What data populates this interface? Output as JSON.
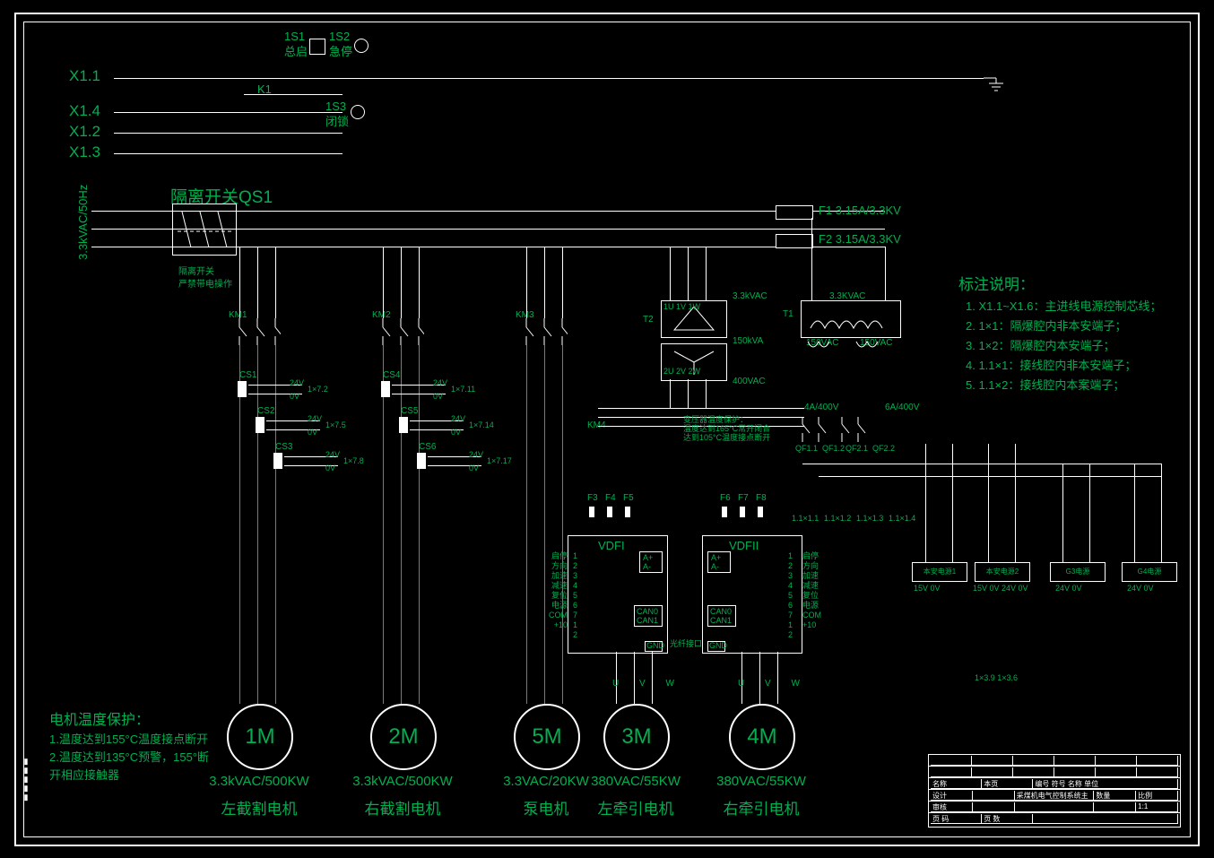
{
  "diagram_title": "采煤机电气控制系统主接线图",
  "top_controls": {
    "s1": {
      "ref": "1S1",
      "label": "总启"
    },
    "s2": {
      "ref": "1S2",
      "label": "急停"
    },
    "s3": {
      "ref": "1S3",
      "label": "闭锁"
    },
    "relay": "K1"
  },
  "control_wires": [
    "X1.1",
    "X1.4",
    "X1.2",
    "X1.3"
  ],
  "supply": {
    "label": "3.3kVAC/50Hz"
  },
  "isolator": {
    "name": "隔离开关QS1",
    "warning": "隔离开关\n严禁带电操作"
  },
  "contactors": [
    "KM1",
    "KM2",
    "KM3",
    "KM4"
  ],
  "ct_blocks": {
    "left": [
      "CS1",
      "CS2",
      "CS3"
    ],
    "right": [
      "CS4",
      "CS5",
      "CS6"
    ],
    "vals": [
      "24V",
      "0V"
    ],
    "tags_left": [
      "1×7.2",
      "1×7.5",
      "1×7.8"
    ],
    "tags_right": [
      "1×7.11",
      "1×7.14",
      "1×7.17"
    ]
  },
  "fuses_main": {
    "f1": "F1  3.15A/3.3KV",
    "f2": "F2 3.15A/3.3KV"
  },
  "transformers": {
    "t2": {
      "ref": "T2",
      "primary": "3.3kVAC",
      "kva": "150kVA",
      "sec": "400VAC",
      "pins_top": "1U 1V 1W",
      "pins_bot": "2U 2V 2W"
    },
    "t1": {
      "ref": "T1",
      "primary": "3.3KVAC",
      "sec1": "150VAC",
      "sec2": "150VAC"
    }
  },
  "thermal_note": "变压器温度保护：\n温度达到165°C常开闭合\n达到105°C温度接点断开",
  "breakers": {
    "qf11": "QF1.1",
    "qf12": "QF1.2",
    "qf21": "QF2.1",
    "qf22": "QF2.2",
    "r1": "4A/400V",
    "r2": "6A/400V"
  },
  "vfd_fuses": [
    "F3",
    "F4",
    "F5",
    "F6",
    "F7",
    "F8"
  ],
  "vfds": {
    "left": "VDFI",
    "right": "VDFII",
    "io_labels": [
      "启停",
      "方向",
      "加速",
      "减速",
      "复位",
      "电源",
      "COM",
      "+10"
    ],
    "pins": [
      "1",
      "2",
      "3",
      "4",
      "5",
      "6",
      "7",
      "1",
      "2"
    ],
    "extras": [
      "A+",
      "A-",
      "CAN0",
      "CAN1",
      "光纤接口",
      "GND"
    ]
  },
  "phase_labels": "U  V  W",
  "terminal_tags_lower": [
    "1.1×1.1",
    "1.1×1.2",
    "1.1×1.3",
    "1.1×1.4"
  ],
  "terminal_tags_bottom": "1×3.9 1×3.6",
  "power_supplies": [
    {
      "name": "本安电源1",
      "out": "15V  0V"
    },
    {
      "name": "本安电源2",
      "out": "15V  0V  24V  0V"
    },
    {
      "name": "G3电源",
      "out": "24V  0V"
    },
    {
      "name": "G4电源",
      "out": "24V  0V"
    }
  ],
  "motors": [
    {
      "id": "1M",
      "rating": "3.3kVAC/500KW",
      "name": "左截割电机"
    },
    {
      "id": "2M",
      "rating": "3.3kVAC/500KW",
      "name": "右截割电机"
    },
    {
      "id": "5M",
      "rating": "3.3VAC/20KW",
      "name": "泵电机"
    },
    {
      "id": "3M",
      "rating": "380VAC/55KW",
      "name": "左牵引电机"
    },
    {
      "id": "4M",
      "rating": "380VAC/55KW",
      "name": "右牵引电机"
    }
  ],
  "motor_protection": {
    "title": "电机温度保护：",
    "lines": [
      "1.温度达到155°C温度接点断开",
      "2.温度达到135°C预警，155°断",
      "开相应接触器"
    ]
  },
  "legend": {
    "title": "标注说明：",
    "items": [
      "1. X1.1~X1.6：主进线电源控制芯线；",
      "2. 1×1：隔爆腔内非本安端子；",
      "3. 1×2：隔爆腔内本安端子；",
      "4. 1.1×1：接线腔内非本安端子；",
      "5. 1.1×2：接线腔内本案端子；"
    ]
  },
  "titleblock": {
    "rows": [
      [
        "",
        "",
        "",
        "",
        "",
        ""
      ],
      [
        "",
        "",
        "",
        "",
        "",
        ""
      ],
      [
        "",
        "",
        "",
        "",
        "",
        ""
      ],
      [
        "名称",
        "本页",
        "编号 符号 名称 单位",
        "",
        "",
        ""
      ],
      [
        "设计",
        "",
        "",
        "",
        "数量",
        "比例"
      ],
      [
        "审核",
        "",
        "",
        "",
        "",
        "1:1"
      ],
      [
        "页 码",
        "页 数",
        "",
        "采煤机电气控制系统主接线图",
        "",
        ""
      ]
    ]
  }
}
